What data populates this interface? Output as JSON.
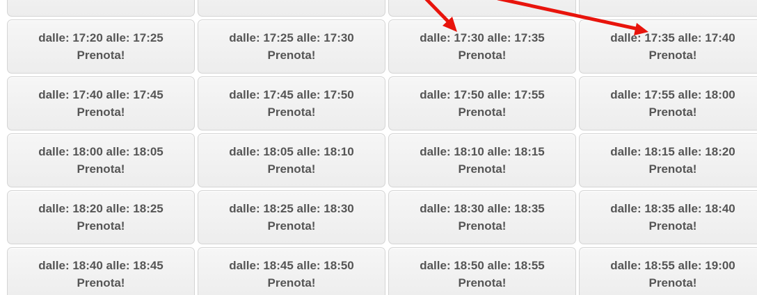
{
  "slots": {
    "partial_row": [
      {
        "time": "",
        "action": ""
      },
      {
        "time": "",
        "action": ""
      },
      {
        "time": "",
        "action": ""
      },
      {
        "time": "",
        "action": ""
      }
    ],
    "rows": [
      [
        {
          "time": "dalle: 17:20 alle: 17:25",
          "action": "Prenota!"
        },
        {
          "time": "dalle: 17:25 alle: 17:30",
          "action": "Prenota!"
        },
        {
          "time": "dalle: 17:30 alle: 17:35",
          "action": "Prenota!"
        },
        {
          "time": "dalle: 17:35 alle: 17:40",
          "action": "Prenota!"
        }
      ],
      [
        {
          "time": "dalle: 17:40 alle: 17:45",
          "action": "Prenota!"
        },
        {
          "time": "dalle: 17:45 alle: 17:50",
          "action": "Prenota!"
        },
        {
          "time": "dalle: 17:50 alle: 17:55",
          "action": "Prenota!"
        },
        {
          "time": "dalle: 17:55 alle: 18:00",
          "action": "Prenota!"
        }
      ],
      [
        {
          "time": "dalle: 18:00 alle: 18:05",
          "action": "Prenota!"
        },
        {
          "time": "dalle: 18:05 alle: 18:10",
          "action": "Prenota!"
        },
        {
          "time": "dalle: 18:10 alle: 18:15",
          "action": "Prenota!"
        },
        {
          "time": "dalle: 18:15 alle: 18:20",
          "action": "Prenota!"
        }
      ],
      [
        {
          "time": "dalle: 18:20 alle: 18:25",
          "action": "Prenota!"
        },
        {
          "time": "dalle: 18:25 alle: 18:30",
          "action": "Prenota!"
        },
        {
          "time": "dalle: 18:30 alle: 18:35",
          "action": "Prenota!"
        },
        {
          "time": "dalle: 18:35 alle: 18:40",
          "action": "Prenota!"
        }
      ],
      [
        {
          "time": "dalle: 18:40 alle: 18:45",
          "action": "Prenota!"
        },
        {
          "time": "dalle: 18:45 alle: 18:50",
          "action": "Prenota!"
        },
        {
          "time": "dalle: 18:50 alle: 18:55",
          "action": "Prenota!"
        },
        {
          "time": "dalle: 18:55 alle: 19:00",
          "action": "Prenota!"
        }
      ]
    ]
  },
  "annotation": {
    "arrow_color": "#e8140c"
  },
  "colors": {
    "button_text": "#555555",
    "button_border": "#d4d4d4",
    "button_bg": "#f0f0f0"
  }
}
